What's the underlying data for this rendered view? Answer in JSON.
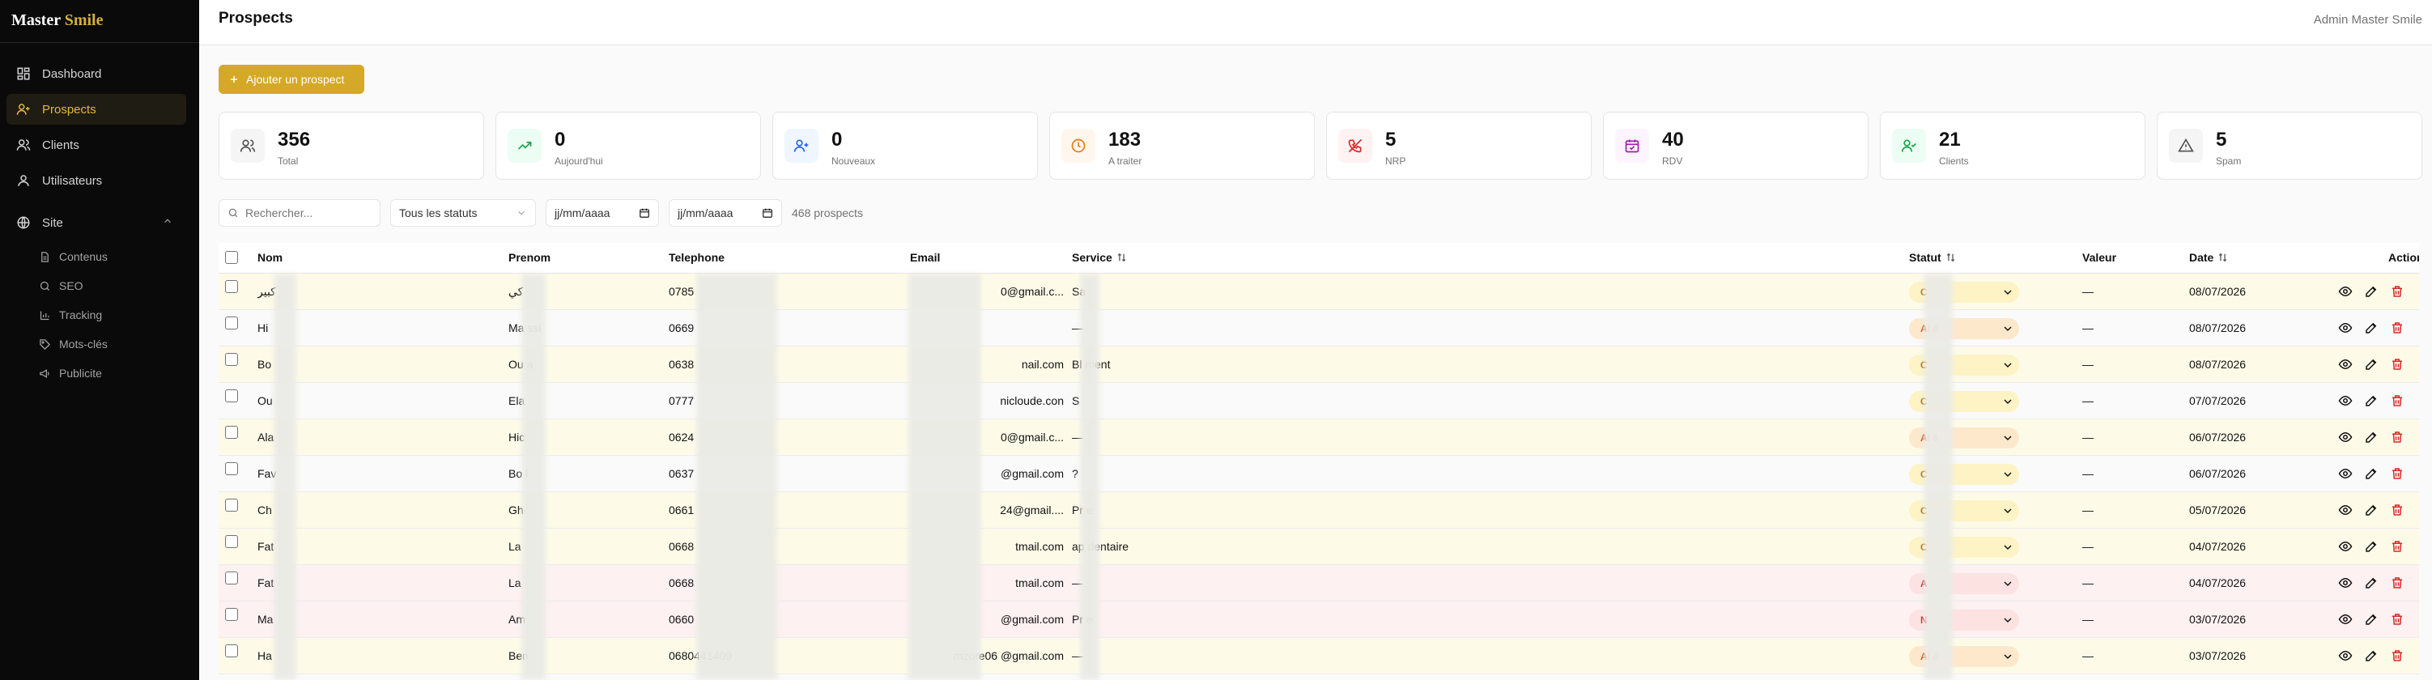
{
  "brand": {
    "part1": "Master",
    "part2": "Smile"
  },
  "sidebar": {
    "items": [
      {
        "label": "Dashboard",
        "icon": "grid-icon"
      },
      {
        "label": "Prospects",
        "icon": "user-plus-icon",
        "active": true
      },
      {
        "label": "Clients",
        "icon": "users-icon"
      },
      {
        "label": "Utilisateurs",
        "icon": "user-icon"
      },
      {
        "label": "Site",
        "icon": "globe-icon"
      }
    ],
    "site_children": [
      {
        "label": "Contenus",
        "icon": "file-icon"
      },
      {
        "label": "SEO",
        "icon": "search-icon"
      },
      {
        "label": "Tracking",
        "icon": "bar-chart-icon"
      },
      {
        "label": "Mots-clés",
        "icon": "tag-icon"
      },
      {
        "label": "Publicite",
        "icon": "megaphone-icon"
      }
    ]
  },
  "header": {
    "title": "Prospects",
    "admin": "Admin Master Smile"
  },
  "add_button": "Ajouter un prospect",
  "stats": [
    {
      "value": "356",
      "label": "Total",
      "icon": "users-icon",
      "color": "#525252",
      "bg": "#f5f5f5"
    },
    {
      "value": "0",
      "label": "Aujourd'hui",
      "icon": "trending-up-icon",
      "color": "#16a34a",
      "bg": "#ecfdf3"
    },
    {
      "value": "0",
      "label": "Nouveaux",
      "icon": "user-plus-icon",
      "color": "#2563eb",
      "bg": "#eff6ff"
    },
    {
      "value": "183",
      "label": "A traiter",
      "icon": "clock-icon",
      "color": "#ea7a0b",
      "bg": "#fff7ed"
    },
    {
      "value": "5",
      "label": "NRP",
      "icon": "phone-off-icon",
      "color": "#dc2626",
      "bg": "#fef2f2"
    },
    {
      "value": "40",
      "label": "RDV",
      "icon": "calendar-icon",
      "color": "#a21caf",
      "bg": "#fdf4ff"
    },
    {
      "value": "21",
      "label": "Clients",
      "icon": "user-check-icon",
      "color": "#16a34a",
      "bg": "#ecfdf3"
    },
    {
      "value": "5",
      "label": "Spam",
      "icon": "alert-triangle-icon",
      "color": "#525252",
      "bg": "#f5f5f5"
    }
  ],
  "filters": {
    "search_placeholder": "Rechercher...",
    "status": "Tous les statuts",
    "date_from": "jj/mm/aaaa",
    "date_to": "jj/mm/aaaa",
    "count": "468 prospects"
  },
  "table": {
    "headers": {
      "nom": "Nom",
      "prenom": "Prenom",
      "telephone": "Telephone",
      "email": "Email",
      "service": "Service",
      "statut": "Statut",
      "valeur": "Valeur",
      "date": "Date",
      "actions": "Actions"
    },
    "rows": [
      {
        "nom": "كبير",
        "prenom": "كي",
        "tel": "0785",
        "email": "0@gmail.c...",
        "service": "Sa",
        "status": "C",
        "status_color": "yellow",
        "valeur": "—",
        "date": "08/07/2026",
        "tint": "yellow"
      },
      {
        "nom": "Hi",
        "prenom": "Ma    ssi",
        "tel": "0669",
        "email": "",
        "service": "—",
        "status": "Al        é",
        "status_color": "orange",
        "valeur": "—",
        "date": "08/07/2026",
        "tint": "white"
      },
      {
        "nom": "Bo",
        "prenom": "Ou     a",
        "tel": "0638",
        "email": "nail.com",
        "service": "Bl      ment",
        "status": "C",
        "status_color": "yellow",
        "valeur": "—",
        "date": "08/07/2026",
        "tint": "yellow"
      },
      {
        "nom": "Ou",
        "prenom": "Ela",
        "tel": "0777",
        "email": "nicloude.con",
        "service": "S",
        "status": "C",
        "status_color": "yellow",
        "valeur": "—",
        "date": "07/07/2026",
        "tint": "white"
      },
      {
        "nom": "Ala",
        "prenom": "Hic",
        "tel": "0624",
        "email": "0@gmail.c...",
        "service": "—",
        "status": "Al        é",
        "status_color": "orange",
        "valeur": "—",
        "date": "06/07/2026",
        "tint": "yellow"
      },
      {
        "nom": "Fav",
        "prenom": "Bo     l",
        "tel": "0637",
        "email": "@gmail.com",
        "service": "?",
        "status": "C",
        "status_color": "yellow",
        "valeur": "—",
        "date": "06/07/2026",
        "tint": "white"
      },
      {
        "nom": "Ch",
        "prenom": "Gh",
        "tel": "0661",
        "email": "24@gmail....",
        "service": "Pr      e",
        "status": "C",
        "status_color": "yellow",
        "valeur": "—",
        "date": "05/07/2026",
        "tint": "yellow"
      },
      {
        "nom": "Fat",
        "prenom": "La",
        "tel": "0668",
        "email": "tmail.com",
        "service": "ap      dentaire",
        "status": "C",
        "status_color": "yellow",
        "valeur": "—",
        "date": "04/07/2026",
        "tint": "yellow"
      },
      {
        "nom": "Fat",
        "prenom": "La",
        "tel": "0668",
        "email": "tmail.com",
        "service": "—",
        "status": "A",
        "status_color": "red",
        "valeur": "—",
        "date": "04/07/2026",
        "tint": "pink"
      },
      {
        "nom": "Ma",
        "prenom": "Am",
        "tel": "0660",
        "email": "@gmail.com",
        "service": "Pr      e",
        "status": "N",
        "status_color": "red",
        "valeur": "—",
        "date": "03/07/2026",
        "tint": "pink"
      },
      {
        "nom": "Ha",
        "prenom": "Ben",
        "tel": "0680441409",
        "email": "mzore06 @gmail.com",
        "service": "—",
        "status": "Al        é",
        "status_color": "orange",
        "valeur": "—",
        "date": "03/07/2026",
        "tint": "yellow"
      }
    ]
  },
  "colors": {
    "accent": "#d4a928",
    "sidebar_bg": "#0a0a0a",
    "delete": "#dc2626"
  }
}
